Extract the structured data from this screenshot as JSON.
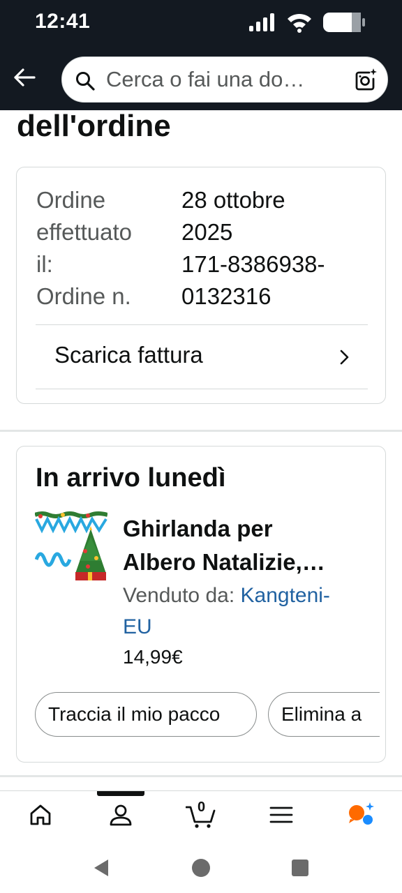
{
  "status_bar": {
    "time": "12:41"
  },
  "header": {
    "search_placeholder": "Cerca o fai una do…"
  },
  "page": {
    "title": "dell'ordine"
  },
  "order_info": {
    "date_label_lines": [
      "Ordine",
      "effettuato",
      "il:"
    ],
    "date_value_lines": [
      "28 ottobre",
      "2025"
    ],
    "number_label": "Ordine n.",
    "number_value_lines": [
      "171-8386938-",
      "0132316"
    ],
    "invoice_label": "Scarica fattura"
  },
  "shipment": {
    "title": "In arrivo lunedì",
    "product": {
      "name_lines": [
        "Ghirlanda per",
        "Albero Natalizie,…"
      ],
      "sold_by_label": "Venduto da: ",
      "seller": "Kangteni-",
      "seller_line2": "EU",
      "price": "14,99€"
    },
    "buttons": {
      "track": "Traccia il mio pacco",
      "delete": "Elimina a"
    }
  },
  "bottom_nav": {
    "cart_count": "0",
    "active_index": 1
  },
  "colors": {
    "header_bg": "#131921",
    "link": "#2162a1",
    "assistant_orange": "#ff6a00",
    "assistant_blue": "#1a8cff"
  }
}
